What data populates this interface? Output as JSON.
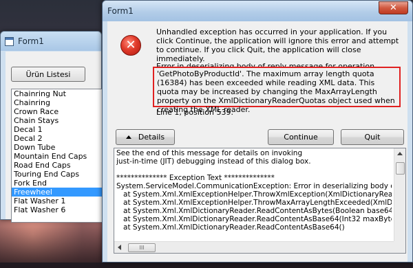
{
  "background_window": {
    "title": "Form1",
    "button_label": "Ürün Listesi",
    "list_items": [
      "Chainring Nut",
      "Chainring",
      "Crown Race",
      "Chain Stays",
      "Decal 1",
      "Decal 2",
      "Down Tube",
      "Mountain End Caps",
      "Road End Caps",
      "Touring End Caps",
      "Fork End",
      "Freewheel",
      "Flat Washer 1",
      "Flat Washer 6"
    ],
    "selected_item": "Freewheel"
  },
  "dialog": {
    "title": "Form1",
    "close_label": "✕",
    "intro": "Unhandled exception has occurred in your application. If you click Continue, the application will ignore this error and attempt to continue. If you click Quit, the application will close immediately.",
    "detail_heading": "Error in deserializing body of reply message for operation",
    "detail_box": "'GetPhotoByProductId'. The maximum array length quota (16384) has been exceeded while reading XML data. This quota may be increased by changing the MaxArrayLength property on the XmlDictionaryReaderQuotas object used when creating the XML reader.",
    "line_position": "Line 1, position 539.",
    "buttons": {
      "details": "Details",
      "continue": "Continue",
      "quit": "Quit"
    },
    "details_lines": [
      "See the end of this message for details on invoking",
      "just-in-time (JIT) debugging instead of this dialog box.",
      "",
      "************** Exception Text **************",
      "System.ServiceModel.CommunicationException: Error in deserializing body of reply me",
      "   at System.Xml.XmlExceptionHelper.ThrowXmlException(XmlDictionaryReader reade",
      "   at System.Xml.XmlExceptionHelper.ThrowMaxArrayLengthExceeded(XmlDictionary",
      "   at System.Xml.XmlDictionaryReader.ReadContentAsBytes(Boolean base64, Int32 m",
      "   at System.Xml.XmlDictionaryReader.ReadContentAsBase64(Int32 maxByteArrayCo",
      "   at System.Xml.XmlDictionaryReader.ReadContentAsBase64()"
    ],
    "hscroll_thumb_label": "III"
  },
  "colors": {
    "highlight_border": "#e02020",
    "selection": "#3399ff"
  }
}
